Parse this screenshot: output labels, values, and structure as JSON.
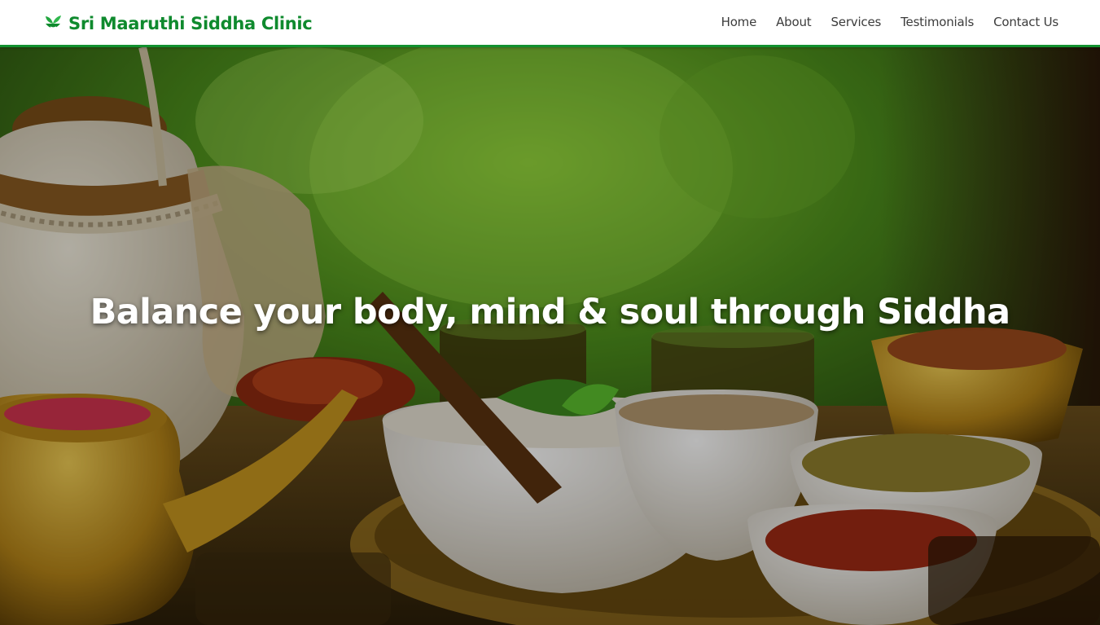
{
  "brand": {
    "name": "Sri Maaruthi Siddha Clinic",
    "icon": "herbal-leaf-mortar-icon",
    "color": "#0f8a2e"
  },
  "nav": {
    "items": [
      {
        "label": "Home"
      },
      {
        "label": "About"
      },
      {
        "label": "Services"
      },
      {
        "label": "Testimonials"
      },
      {
        "label": "Contact Us"
      }
    ]
  },
  "hero": {
    "title": "Balance your body, mind & soul through Siddha",
    "image": "herbal-medicine-background-image"
  },
  "colors": {
    "accent": "#12912f",
    "nav_text": "#3c3c3c",
    "hero_text": "#ffffff"
  }
}
